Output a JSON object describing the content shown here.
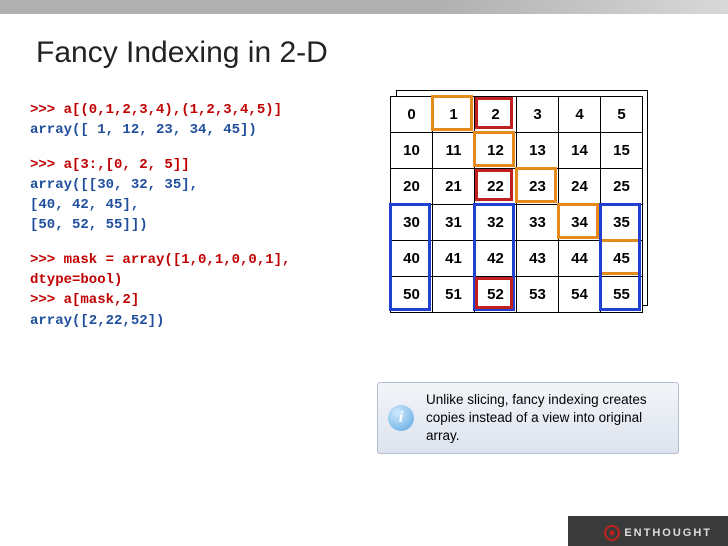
{
  "title": "Fancy Indexing in 2-D",
  "code": {
    "l1": ">>> a[(0,1,2,3,4),(1,2,3,4,5)]",
    "l2": "array([ 1, 12, 23, 34, 45])",
    "l3": ">>> a[3:,[0, 2, 5]]",
    "l4": "array([[30, 32, 35],",
    "l5": "       [40, 42, 45],",
    "l6": "       [50, 52, 55]])",
    "l7": ">>> mask = array([1,0,1,0,0,1],",
    "l8": "                  dtype=bool)",
    "l9": ">>> a[mask,2]",
    "l10": "array([2,22,52])"
  },
  "grid": [
    [
      "0",
      "1",
      "2",
      "3",
      "4",
      "5"
    ],
    [
      "10",
      "11",
      "12",
      "13",
      "14",
      "15"
    ],
    [
      "20",
      "21",
      "22",
      "23",
      "24",
      "25"
    ],
    [
      "30",
      "31",
      "32",
      "33",
      "34",
      "35"
    ],
    [
      "40",
      "41",
      "42",
      "43",
      "44",
      "45"
    ],
    [
      "50",
      "51",
      "52",
      "53",
      "54",
      "55"
    ]
  ],
  "note": {
    "icon": "i",
    "text": "Unlike slicing, fancy indexing creates copies instead of a view into original array."
  },
  "footer": {
    "brand": "ENTHOUGHT"
  },
  "chart_data": {
    "type": "table",
    "title": "2-D array a (6×6)",
    "columns": [
      0,
      1,
      2,
      3,
      4,
      5
    ],
    "rows": [
      [
        0,
        1,
        2,
        3,
        4,
        5
      ],
      [
        10,
        11,
        12,
        13,
        14,
        15
      ],
      [
        20,
        21,
        22,
        23,
        24,
        25
      ],
      [
        30,
        31,
        32,
        33,
        34,
        35
      ],
      [
        40,
        41,
        42,
        43,
        44,
        45
      ],
      [
        50,
        51,
        52,
        53,
        54,
        55
      ]
    ],
    "highlights": {
      "orange_diagonal_cells": [
        [
          0,
          1
        ],
        [
          1,
          2
        ],
        [
          2,
          3
        ],
        [
          3,
          4
        ],
        [
          4,
          5
        ]
      ],
      "blue_rows_cols": {
        "rows": [
          3,
          4,
          5
        ],
        "cols": [
          0,
          2,
          5
        ]
      },
      "red_mask_col2_rows": [
        0,
        2,
        5
      ]
    }
  }
}
